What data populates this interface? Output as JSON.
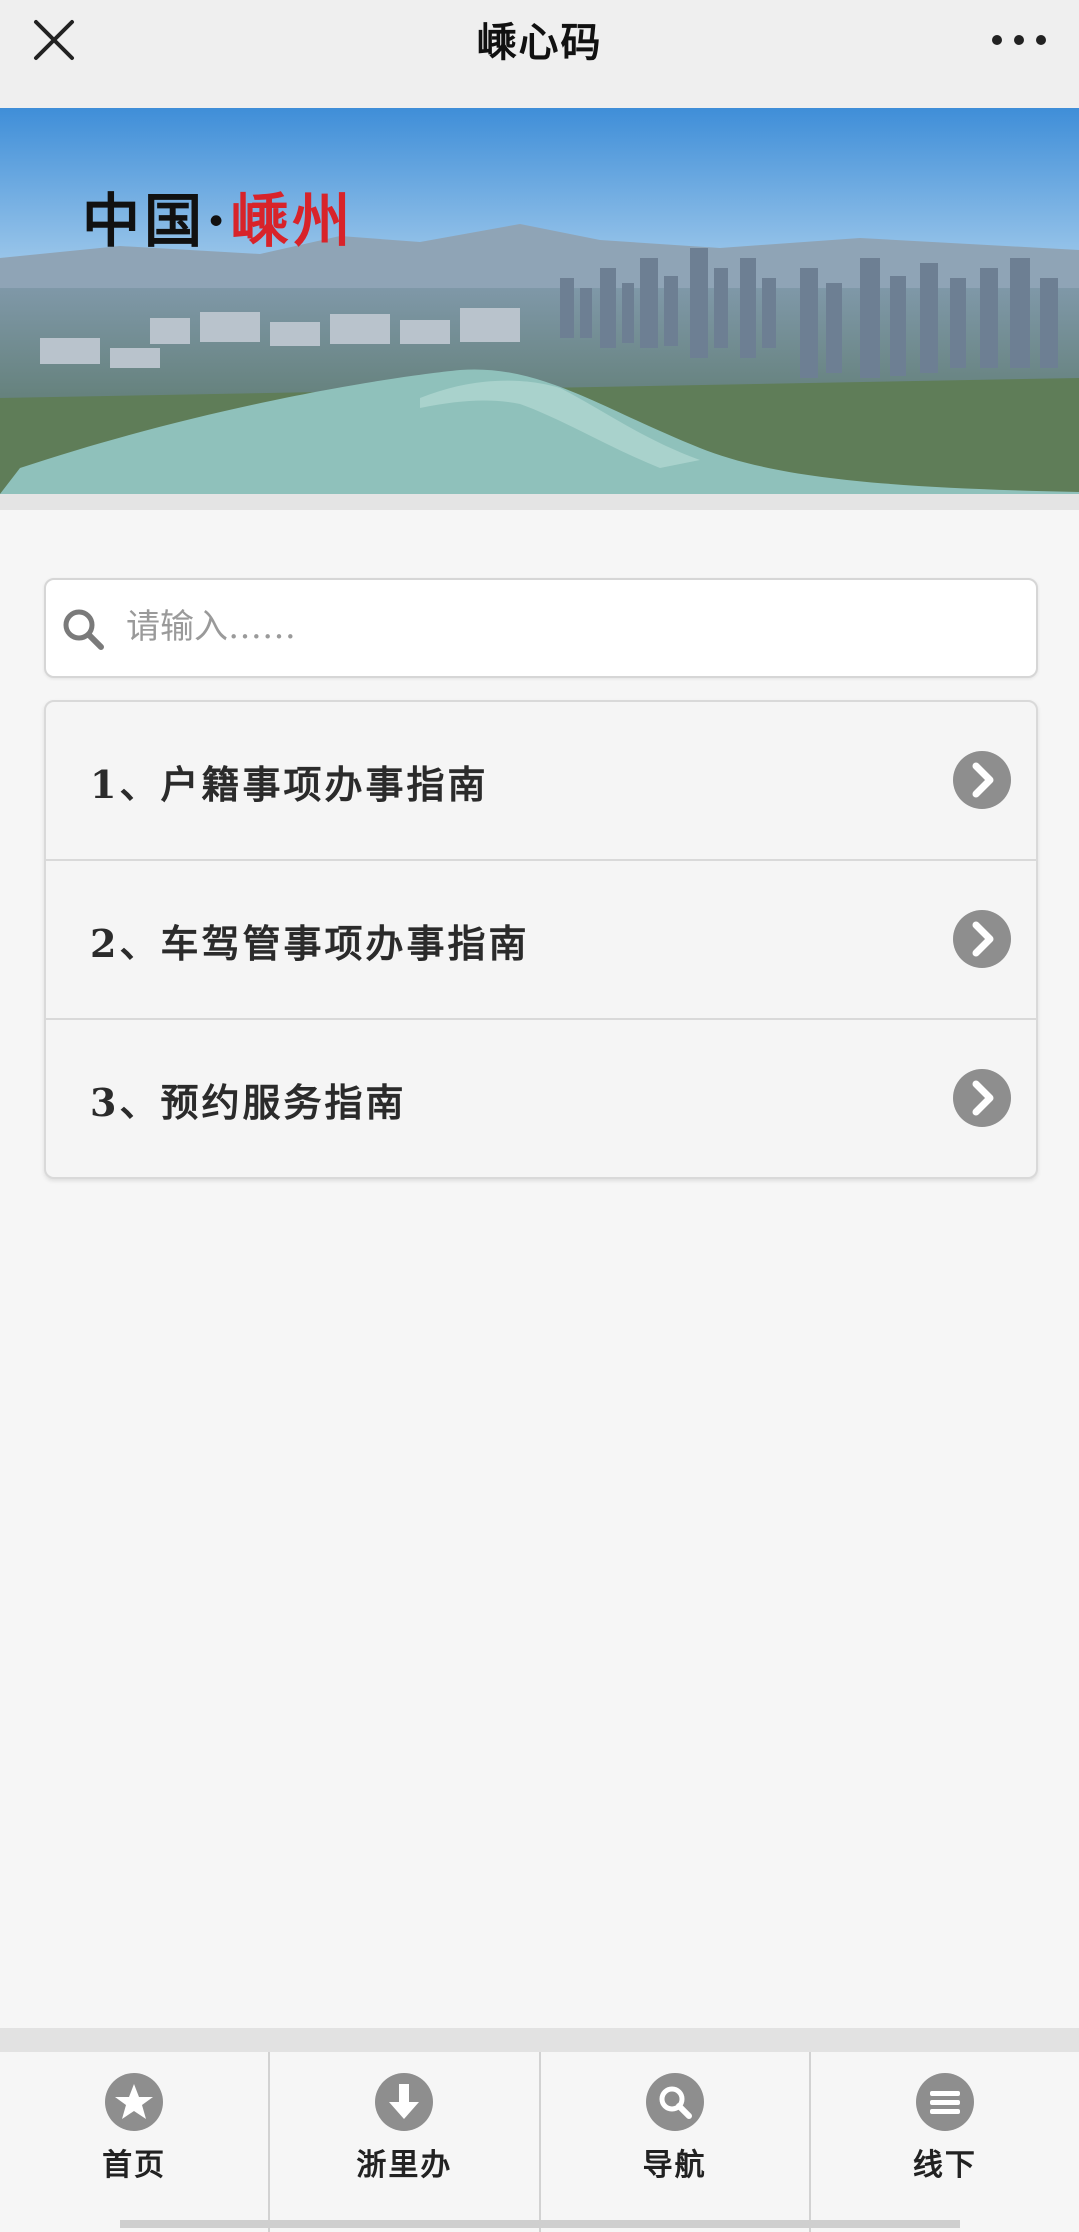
{
  "header": {
    "title": "嵊心码",
    "close_icon": "close-icon",
    "more_icon": "more-dots-icon"
  },
  "banner": {
    "caption_prefix": "中国·",
    "caption_city": "嵊州",
    "accent_color": "#d8232a"
  },
  "search": {
    "placeholder": "请输入……",
    "icon": "search-icon"
  },
  "guides": [
    {
      "label": "1、户籍事项办事指南",
      "icon": "chevron-right-circle-icon"
    },
    {
      "label": "2、车驾管事项办事指南",
      "icon": "chevron-right-circle-icon"
    },
    {
      "label": "3、预约服务指南",
      "icon": "chevron-right-circle-icon"
    }
  ],
  "tabbar": {
    "tabs": [
      {
        "label": "首页",
        "icon": "star-icon"
      },
      {
        "label": "浙里办",
        "icon": "download-arrow-icon"
      },
      {
        "label": "导航",
        "icon": "search-icon"
      },
      {
        "label": "线下",
        "icon": "menu-lines-icon"
      }
    ]
  },
  "colors": {
    "icon_gray": "#8e8e8e"
  }
}
